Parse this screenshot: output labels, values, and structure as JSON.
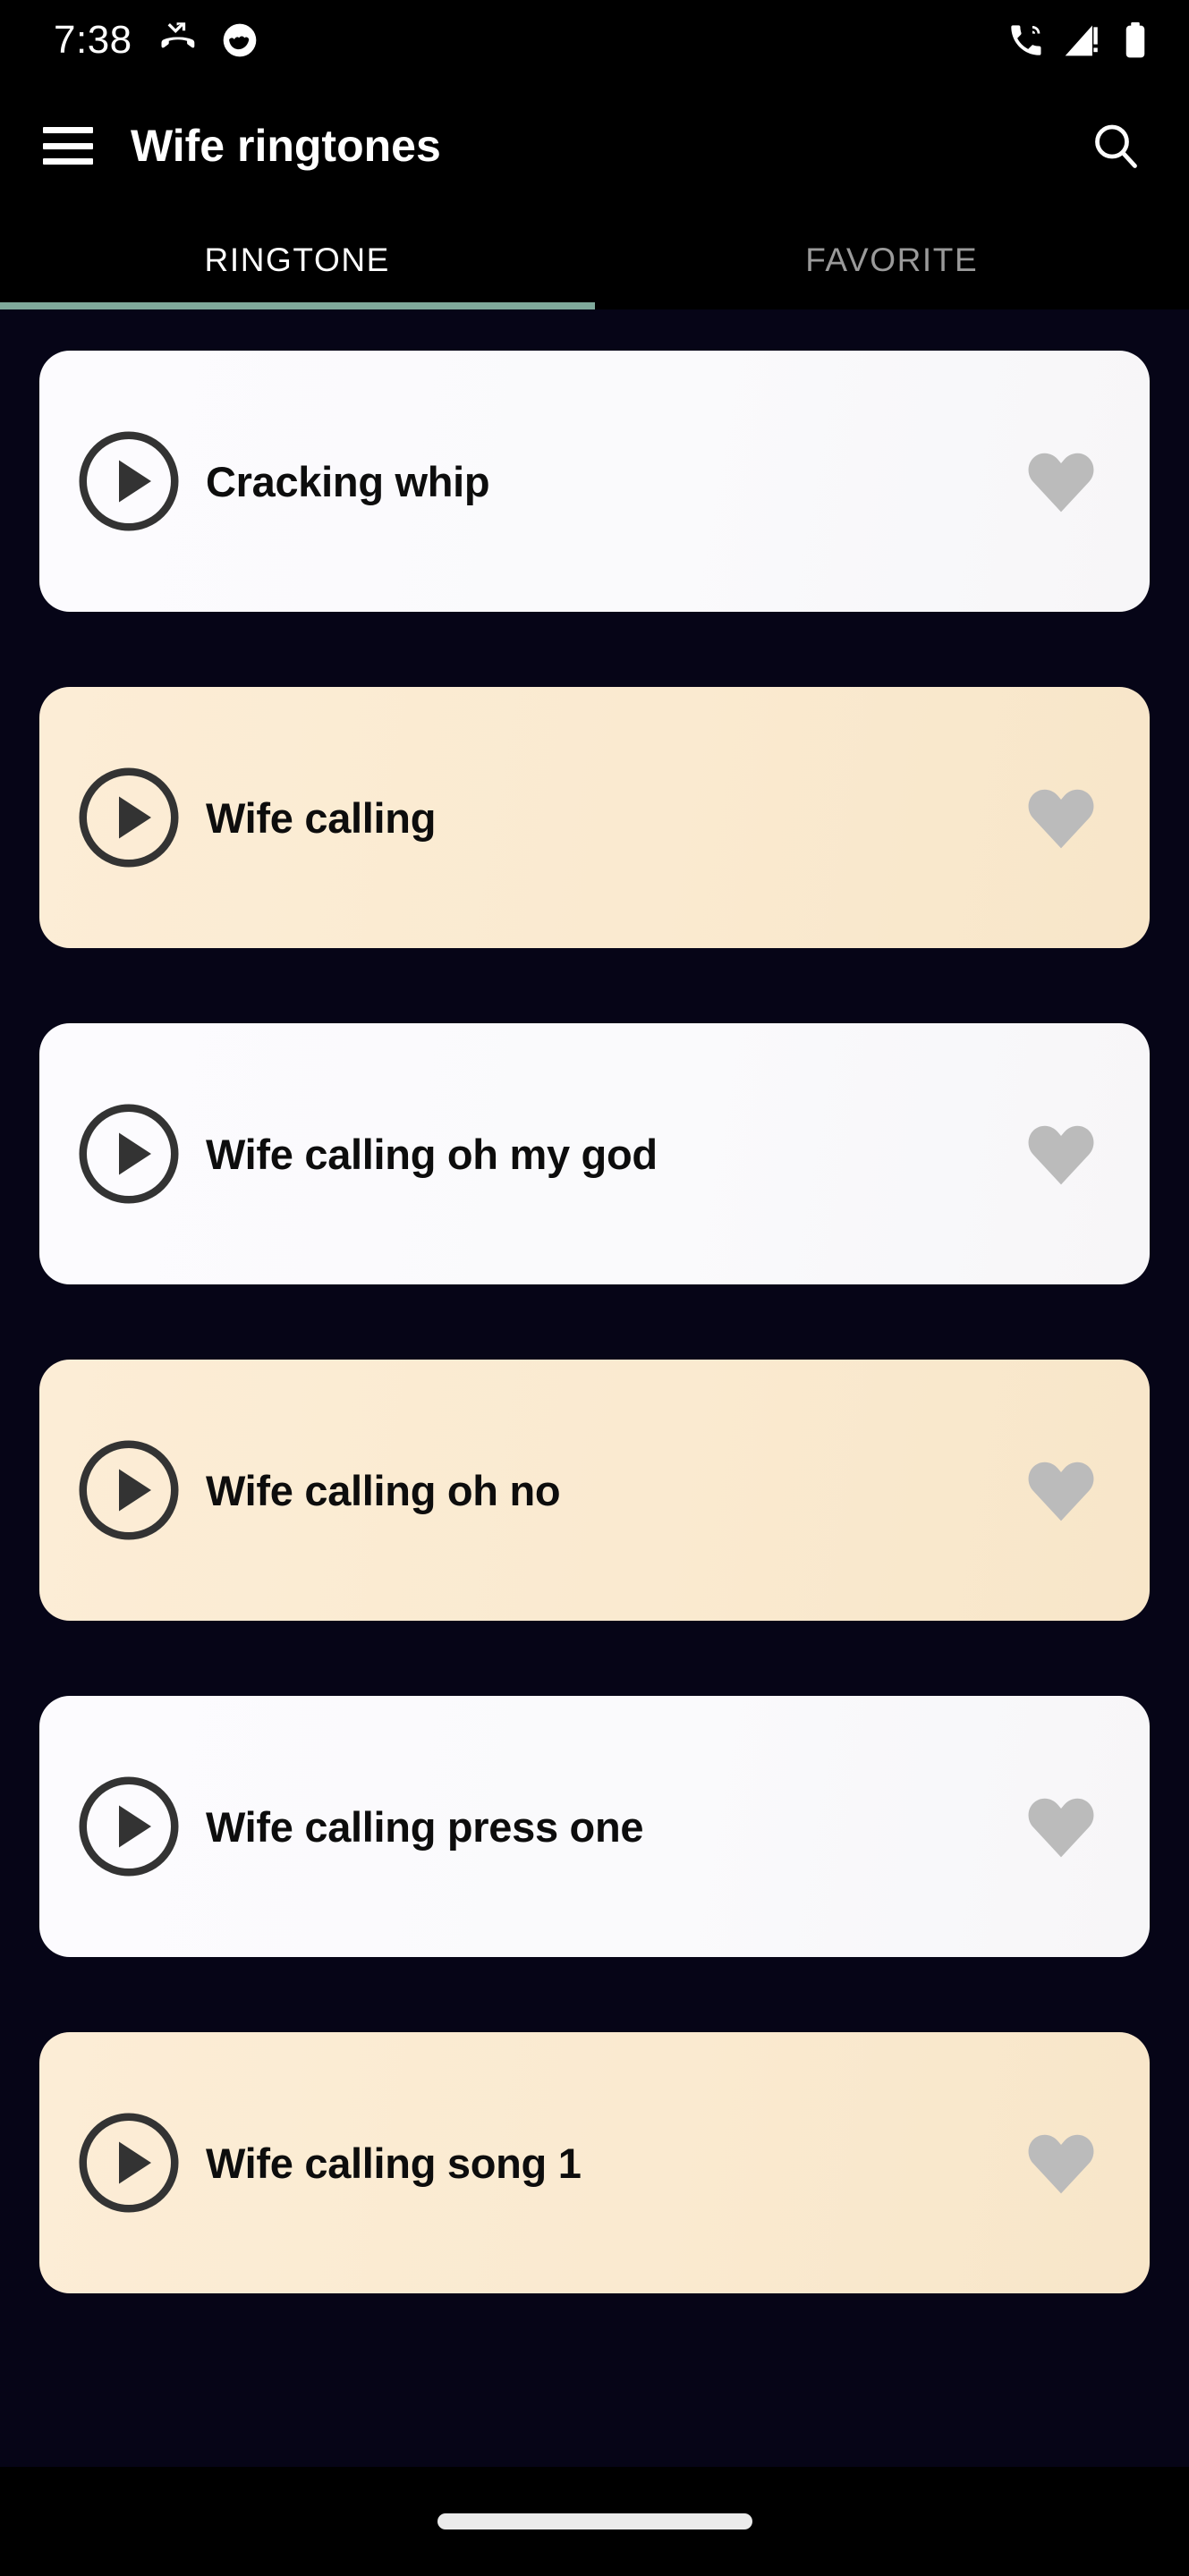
{
  "status_bar": {
    "time": "7:38",
    "notification_icons": [
      "missed-call-icon",
      "app-notification-icon"
    ],
    "system_icons": [
      "wifi-calling-icon",
      "cellular-signal-alert-icon",
      "battery-full-icon"
    ]
  },
  "app_bar": {
    "menu_icon": "hamburger-menu-icon",
    "title": "Wife ringtones",
    "search_icon": "search-icon"
  },
  "tabs": {
    "active_index": 0,
    "items": [
      {
        "label": "RINGTONE"
      },
      {
        "label": "FAVORITE"
      }
    ],
    "indicator_color": "#7FA99B"
  },
  "ringtone_list": {
    "items": [
      {
        "title": "Cracking whip",
        "style": "light",
        "play_icon": "play-circle-icon",
        "favorite_icon": "heart-icon",
        "favorited": false
      },
      {
        "title": "Wife calling",
        "style": "cream",
        "play_icon": "play-circle-icon",
        "favorite_icon": "heart-icon",
        "favorited": false
      },
      {
        "title": "Wife calling oh my god",
        "style": "light",
        "play_icon": "play-circle-icon",
        "favorite_icon": "heart-icon",
        "favorited": false
      },
      {
        "title": "Wife calling oh no",
        "style": "cream",
        "play_icon": "play-circle-icon",
        "favorite_icon": "heart-icon",
        "favorited": false
      },
      {
        "title": "Wife calling press one",
        "style": "light",
        "play_icon": "play-circle-icon",
        "favorite_icon": "heart-icon",
        "favorited": false
      },
      {
        "title": "Wife calling song 1",
        "style": "cream",
        "play_icon": "play-circle-icon",
        "favorite_icon": "heart-icon",
        "favorited": false
      }
    ]
  },
  "nav_bar": {
    "home_indicator": "gesture-home-indicator"
  },
  "colors": {
    "page_background": "#060517",
    "bar_background": "#000000",
    "card_light": "#FAFAFC",
    "card_cream": "#FAEAD0",
    "accent": "#7FA99B",
    "heart_inactive": "#BBBBBB",
    "play_icon": "#333333"
  }
}
